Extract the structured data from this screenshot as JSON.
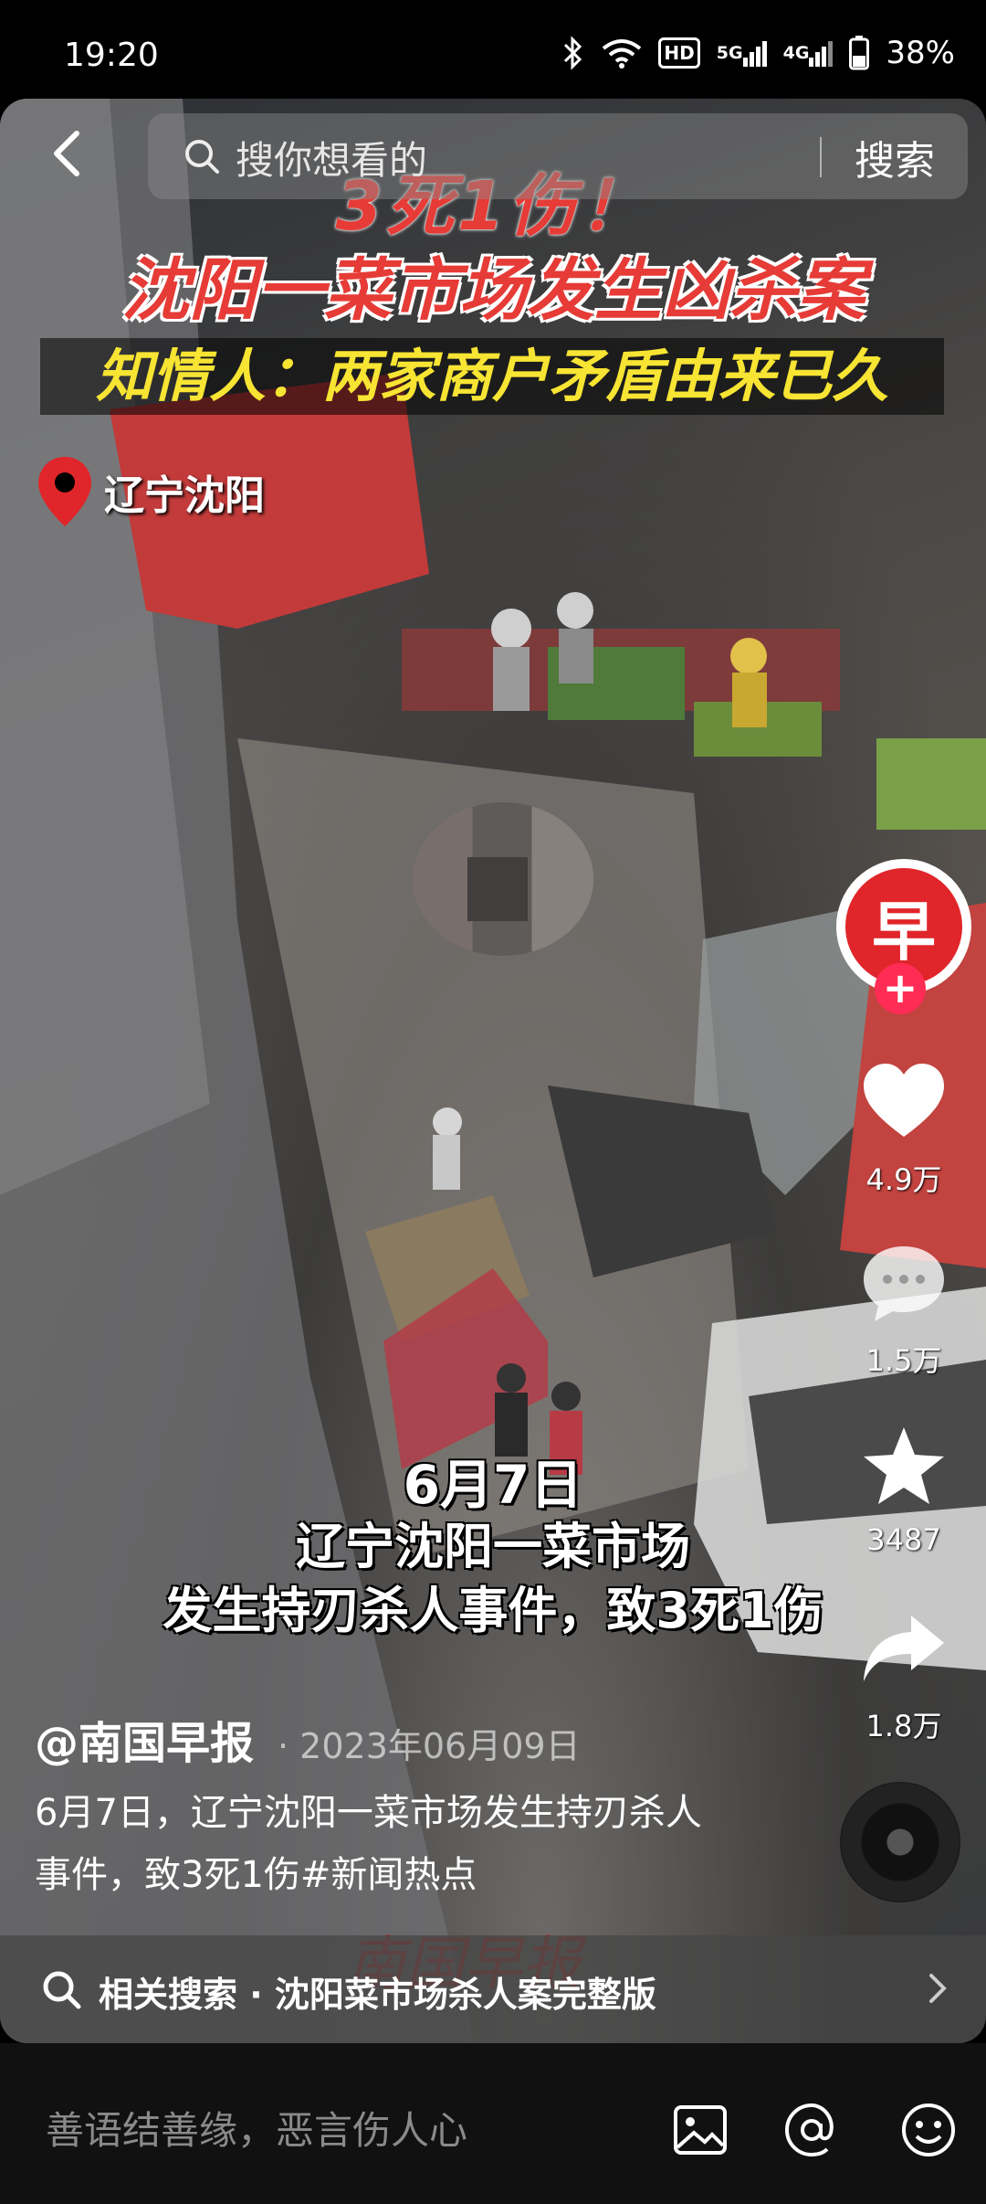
{
  "status_bar": {
    "time": "19:20",
    "hd": "HD",
    "net5g": "5G",
    "net4g": "4G",
    "battery": "38%"
  },
  "search": {
    "placeholder": "搜你想看的",
    "button": "搜索"
  },
  "video": {
    "headline1": "3死1伤！",
    "headline2": "沈阳一菜市场发生凶杀案",
    "headline3": "知情人：两家商户矛盾由来已久",
    "location": "辽宁沈阳",
    "caption_line1": "6月7日",
    "caption_line2": "辽宁沈阳一菜市场",
    "caption_line3": "发生持刃杀人事件，致3死1伤",
    "watermark": "南国早报"
  },
  "rail": {
    "avatar_glyph": "早",
    "follow": "+",
    "likes": "4.9万",
    "comments": "1.5万",
    "favorites": "3487",
    "shares": "1.8万"
  },
  "post": {
    "author": "@南国早报",
    "date": "· 2023年06月09日",
    "description": "6月7日，辽宁沈阳一菜市场发生持刃杀人事件，致3死1伤#新闻热点"
  },
  "related": {
    "text": "相关搜索 · 沈阳菜市场杀人案完整版"
  },
  "comment_bar": {
    "placeholder": "善语结善缘，恶言伤人心"
  },
  "colors": {
    "accent_red": "#e63b36",
    "follow_pink": "#ff2c55",
    "yellow": "#f7e433"
  }
}
